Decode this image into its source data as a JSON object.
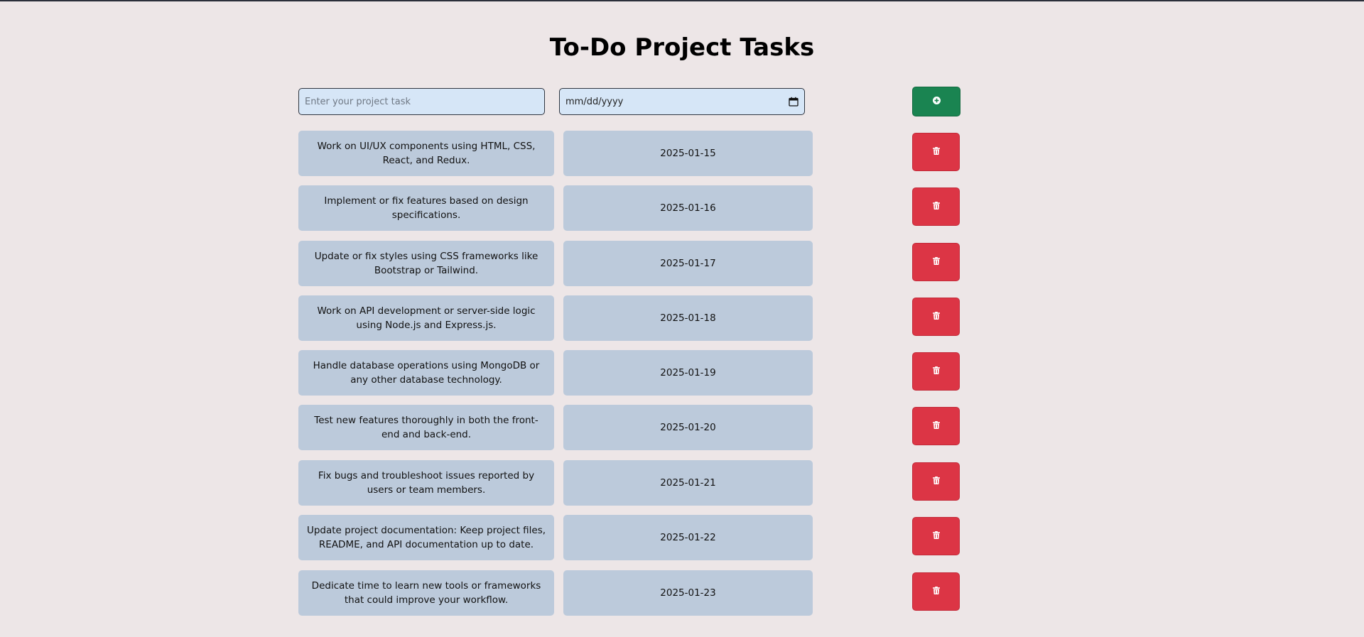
{
  "page": {
    "title": "To-Do Project Tasks"
  },
  "form": {
    "task_placeholder": "Enter your project task",
    "task_value": "",
    "date_placeholder": "mm/dd/yyyy",
    "add_icon": "plus-circle-icon"
  },
  "colors": {
    "background": "#ede6e7",
    "input_bg": "#d6e6f7",
    "card_bg": "#bccadb",
    "add_button": "#1a8451",
    "delete_button": "#dc3545"
  },
  "tasks": [
    {
      "text": "Work on UI/UX components using HTML, CSS, React, and Redux.",
      "date": "2025-01-15",
      "delete_icon": "trash-icon"
    },
    {
      "text": "Implement or fix features based on design specifications.",
      "date": "2025-01-16",
      "delete_icon": "trash-icon"
    },
    {
      "text": "Update or fix styles using CSS frameworks like Bootstrap or Tailwind.",
      "date": "2025-01-17",
      "delete_icon": "trash-icon"
    },
    {
      "text": "Work on API development or server-side logic using Node.js and Express.js.",
      "date": "2025-01-18",
      "delete_icon": "trash-icon"
    },
    {
      "text": "Handle database operations using MongoDB or any other database technology.",
      "date": "2025-01-19",
      "delete_icon": "trash-icon"
    },
    {
      "text": "Test new features thoroughly in both the front-end and back-end.",
      "date": "2025-01-20",
      "delete_icon": "trash-icon"
    },
    {
      "text": "Fix bugs and troubleshoot issues reported by users or team members.",
      "date": "2025-01-21",
      "delete_icon": "trash-icon"
    },
    {
      "text": "Update project documentation: Keep project files, README, and API documentation up to date.",
      "date": "2025-01-22",
      "delete_icon": "trash-icon"
    },
    {
      "text": "Dedicate time to learn new tools or frameworks that could improve your workflow.",
      "date": "2025-01-23",
      "delete_icon": "trash-icon"
    }
  ]
}
